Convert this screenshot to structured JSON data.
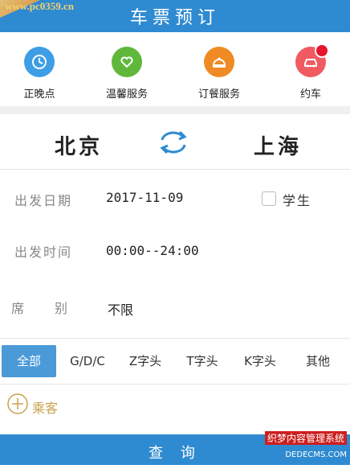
{
  "watermark_top": "www.pc0359.cn",
  "header": {
    "title": "车票预订"
  },
  "quick_links": [
    {
      "label": "正晚点",
      "icon": "clock-icon",
      "color": "#3d9ee6"
    },
    {
      "label": "温馨服务",
      "icon": "heart-hand-icon",
      "color": "#5fb83a"
    },
    {
      "label": "订餐服务",
      "icon": "food-cloche-icon",
      "color": "#f08a24"
    },
    {
      "label": "约车",
      "icon": "car-icon",
      "color": "#ef5b61"
    }
  ],
  "route": {
    "from": "北京",
    "to": "上海"
  },
  "form": {
    "date_label": "出发日期",
    "date_value": "2017-11-09",
    "student_label": "学生",
    "time_label": "出发时间",
    "time_value": "00:00--24:00",
    "seat_label": "席　　别",
    "seat_value": "不限"
  },
  "train_types": [
    "全部",
    "G/D/C",
    "Z字头",
    "T字头",
    "K字头",
    "其他"
  ],
  "add_passenger": "乘客",
  "query_button": "查 询",
  "watermark_bottom": {
    "line1": "织梦内容管理系统",
    "line2": "DEDECMS.COM"
  },
  "colors": {
    "primary": "#2f8bd1",
    "tab_active": "#4b9ad8",
    "accent_gold": "#c9a24c"
  }
}
